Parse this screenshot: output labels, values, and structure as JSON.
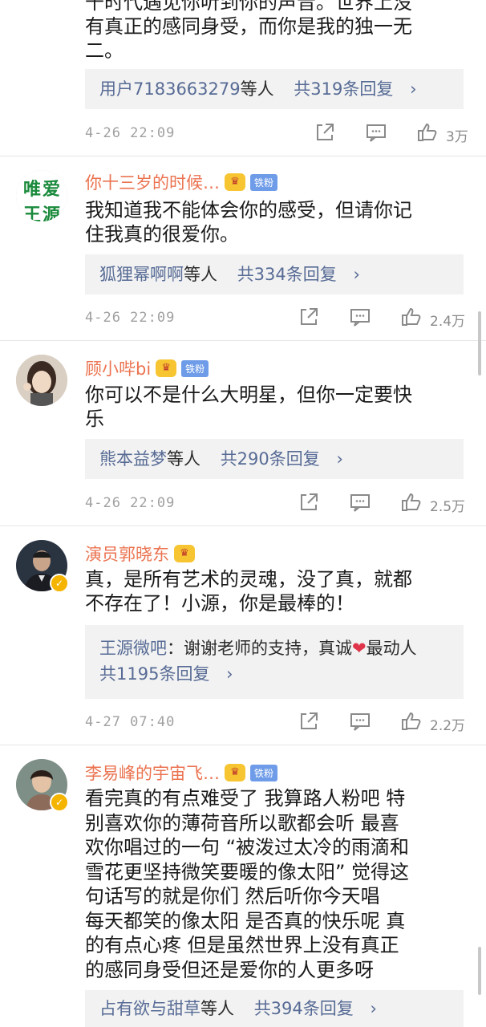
{
  "comments": [
    {
      "content_lines": [
        "千时代遇见你听到你的声音。世界上没",
        "有真正的感同身受，而你是我的独一无",
        "二。"
      ],
      "reply": {
        "users": "用户7183663279",
        "suffix": "等人",
        "count": "共319条回复",
        "chevron": "›"
      },
      "timestamp": "4-26 22:09",
      "likes": "3万"
    },
    {
      "username": "你十三岁的时候…",
      "badge": "铁粉",
      "avatar_chars": [
        "唯",
        "爱",
        "王",
        "源"
      ],
      "content_lines": [
        "我知道我不能体会你的感受，但请你记",
        "住我真的很爱你。"
      ],
      "reply": {
        "users": "狐狸幂啊啊",
        "suffix": "等人",
        "count": "共334条回复",
        "chevron": "›"
      },
      "timestamp": "4-26 22:09",
      "likes": "2.4万"
    },
    {
      "username": "顾小哔bi",
      "badge": "铁粉",
      "content_lines": [
        "你可以不是什么大明星，但你一定要快",
        "乐"
      ],
      "reply": {
        "users": "熊本益梦",
        "suffix": "等人",
        "count": "共290条回复",
        "chevron": "›"
      },
      "timestamp": "4-26 22:09",
      "likes": "2.5万"
    },
    {
      "username": "演员郭晓东",
      "content_lines": [
        "真，是所有艺术的灵魂，没了真，就都",
        "不存在了！小源，你是最棒的！"
      ],
      "reply": {
        "author": "王源微吧",
        "text": "：谢谢老师的支持，真诚",
        "heart": "❤",
        "text2": "最动人",
        "count": "共1195条回复",
        "chevron": "›"
      },
      "timestamp": "4-27 07:40",
      "likes": "2.2万"
    },
    {
      "username": "李易峰的宇宙飞…",
      "badge": "铁粉",
      "content_lines": [
        "看完真的有点难受了  我算路人粉吧  特",
        "别喜欢你的薄荷音所以歌都会听   最喜",
        "欢你唱过的一句  “被泼过太冷的雨滴和",
        "雪花更坚持微笑要暖的像太阳”  觉得这",
        "句话写的就是你们     然后听你今天唱",
        "每天都笑的像太阳  是否真的快乐呢   真",
        "的有点心疼   但是虽然世界上没有真正",
        "的感同身受但还是爱你的人更多呀"
      ],
      "reply": {
        "users": "占有欲与甜草",
        "suffix": "等人",
        "count": "共394条回复",
        "chevron": "›"
      }
    }
  ],
  "colors": {
    "username": "#eb7350",
    "link": "#576b95",
    "fan_badge": "#6f9ce8"
  },
  "icons": [
    "share-icon",
    "comment-icon",
    "like-icon",
    "crown-icon",
    "verified-icon"
  ]
}
